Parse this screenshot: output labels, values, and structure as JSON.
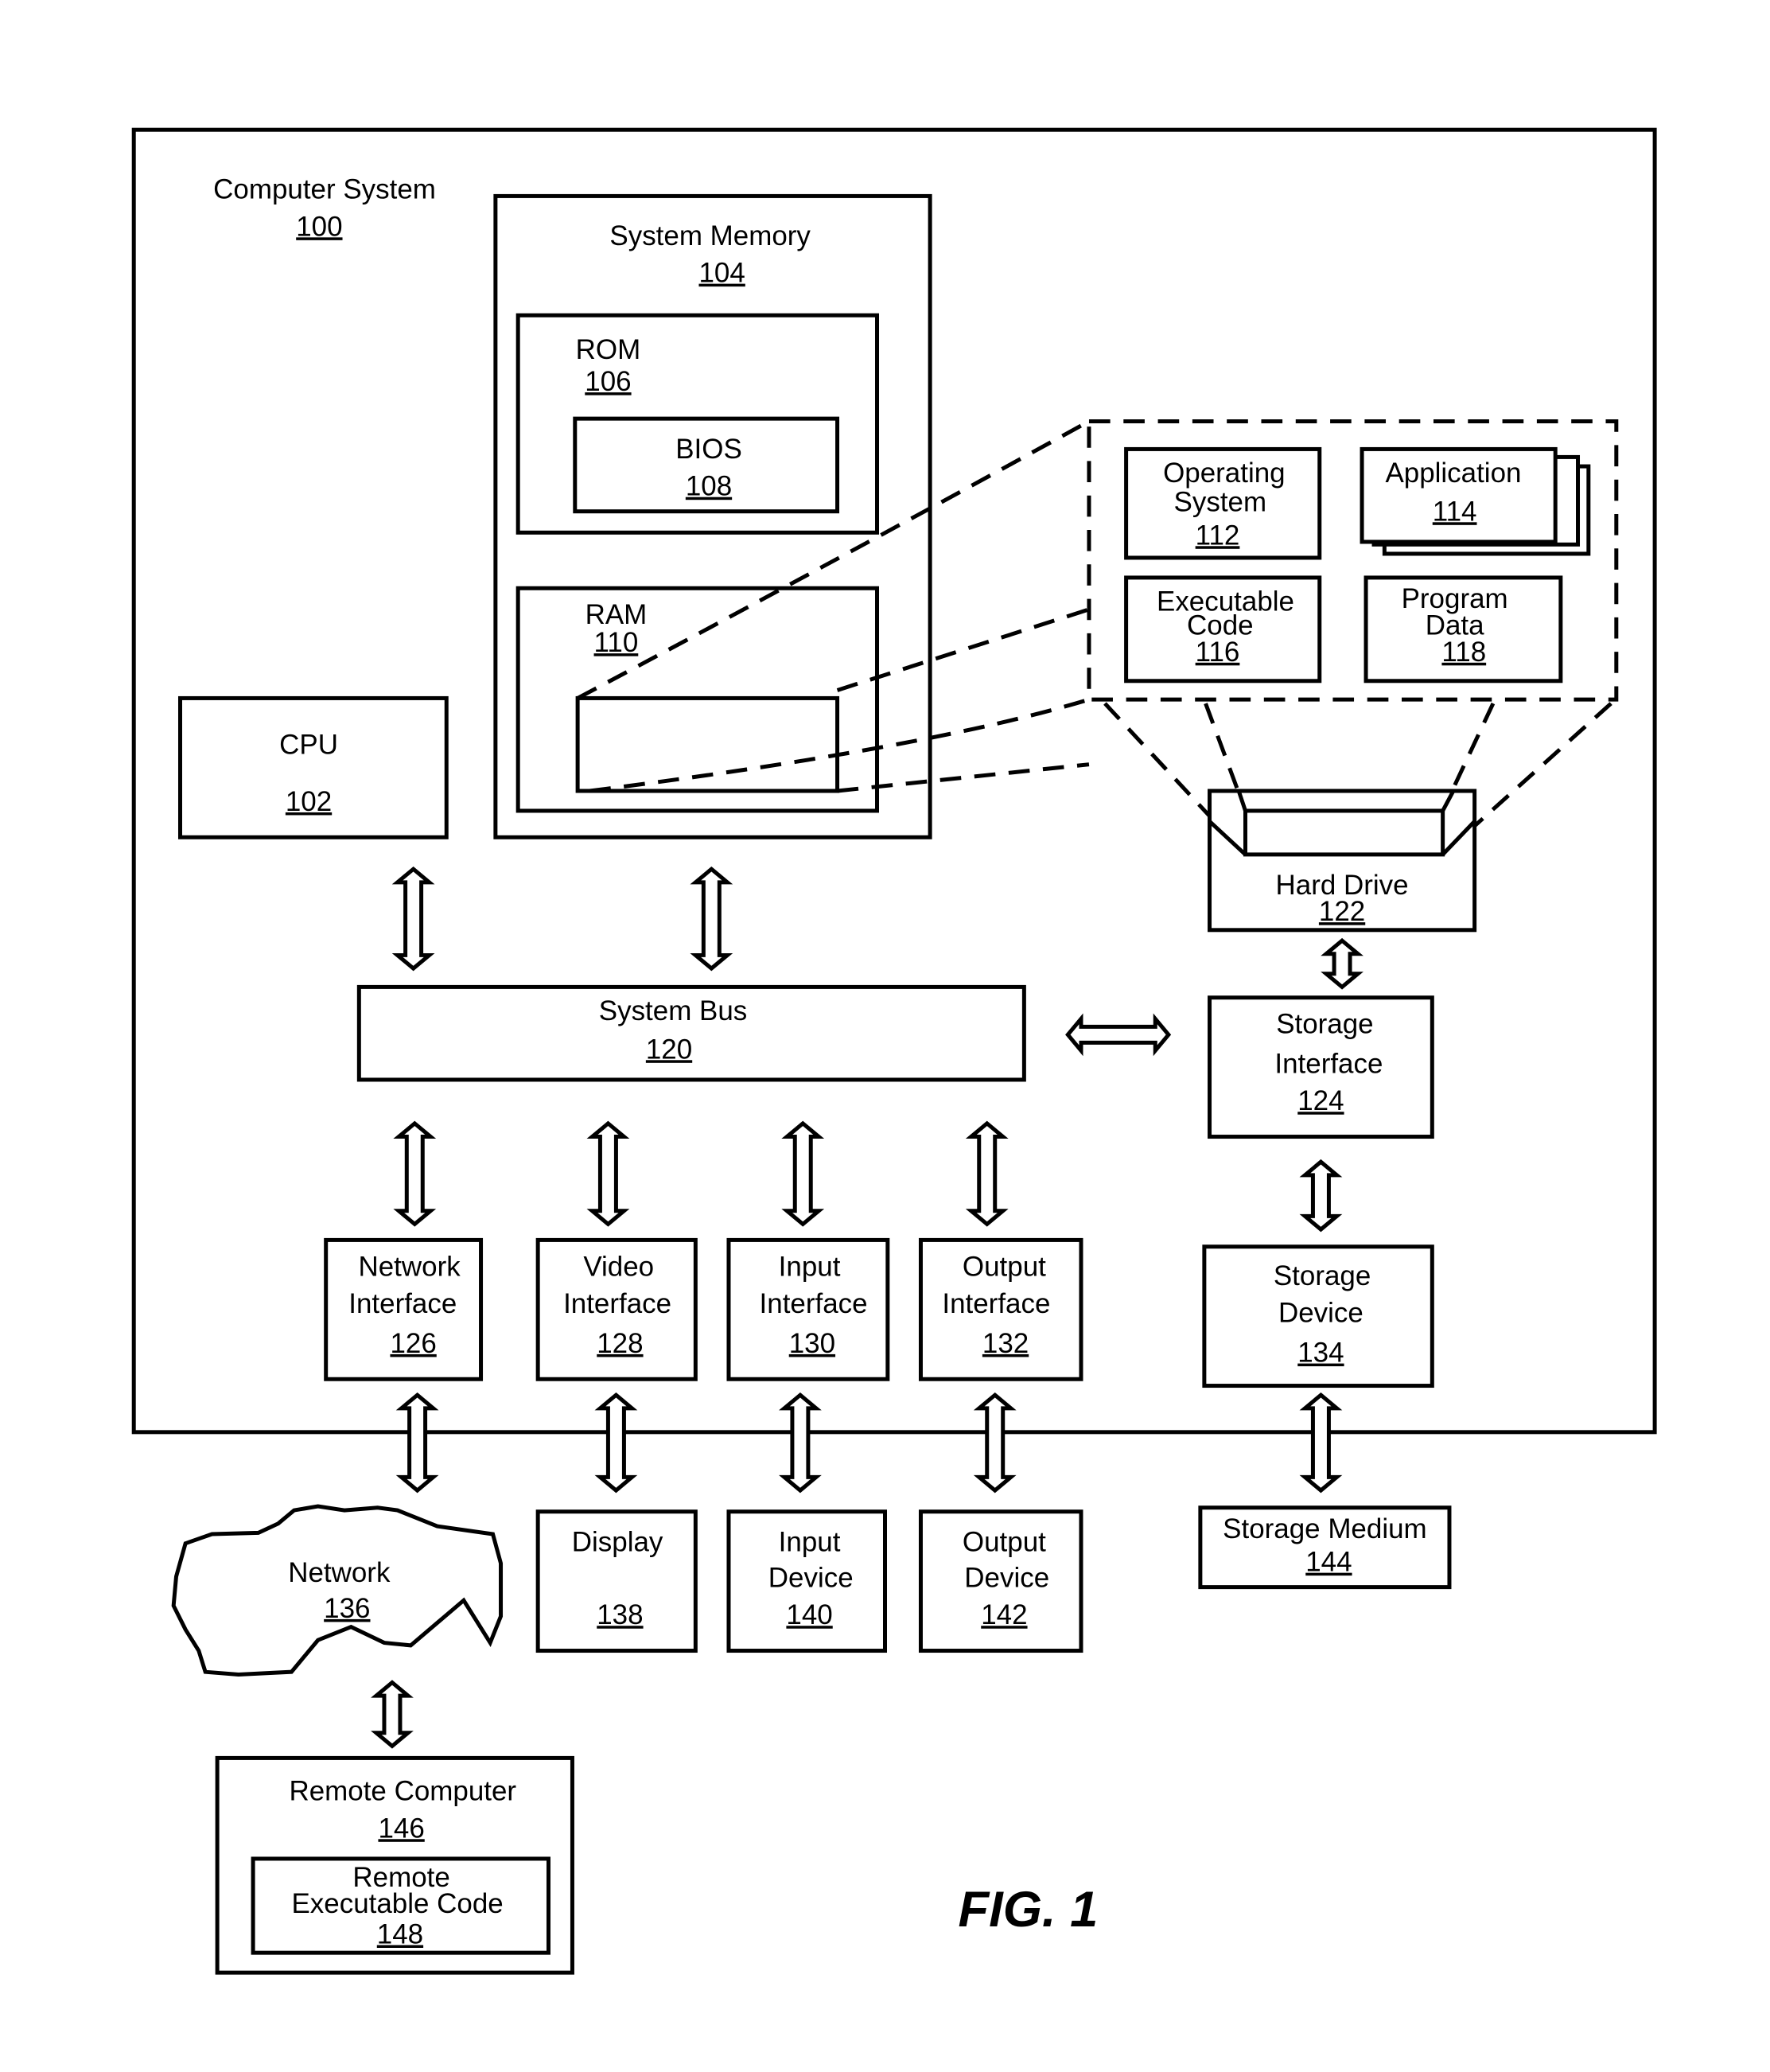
{
  "figure_label": "FIG. 1",
  "components": {
    "computer_system": {
      "label": "Computer System",
      "ref": "100"
    },
    "cpu": {
      "label": "CPU",
      "ref": "102"
    },
    "system_memory": {
      "label": "System Memory",
      "ref": "104"
    },
    "rom": {
      "label": "ROM",
      "ref": "106"
    },
    "bios": {
      "label": "BIOS",
      "ref": "108"
    },
    "ram": {
      "label": "RAM",
      "ref": "110"
    },
    "operating_system": {
      "label_lines": [
        "Operating",
        "System"
      ],
      "ref": "112"
    },
    "application": {
      "label": "Application",
      "ref": "114"
    },
    "executable_code": {
      "label_lines": [
        "Executable",
        "Code"
      ],
      "ref": "116"
    },
    "program_data": {
      "label_lines": [
        "Program",
        "Data"
      ],
      "ref": "118"
    },
    "system_bus": {
      "label": "System Bus",
      "ref": "120"
    },
    "hard_drive": {
      "label": "Hard Drive",
      "ref": "122"
    },
    "storage_interface": {
      "label_lines": [
        "Storage",
        "Interface"
      ],
      "ref": "124"
    },
    "network_interface": {
      "label_lines": [
        "Network",
        "Interface"
      ],
      "ref": "126"
    },
    "video_interface": {
      "label_lines": [
        "Video",
        "Interface"
      ],
      "ref": "128"
    },
    "input_interface": {
      "label_lines": [
        "Input",
        "Interface"
      ],
      "ref": "130"
    },
    "output_interface": {
      "label_lines": [
        "Output",
        "Interface"
      ],
      "ref": "132"
    },
    "storage_device": {
      "label_lines": [
        "Storage",
        "Device"
      ],
      "ref": "134"
    },
    "network": {
      "label": "Network",
      "ref": "136"
    },
    "display": {
      "label": "Display",
      "ref": "138"
    },
    "input_device": {
      "label_lines": [
        "Input",
        "Device"
      ],
      "ref": "140"
    },
    "output_device": {
      "label_lines": [
        "Output",
        "Device"
      ],
      "ref": "142"
    },
    "storage_medium": {
      "label": "Storage Medium",
      "ref": "144"
    },
    "remote_computer": {
      "label": "Remote Computer",
      "ref": "146"
    },
    "remote_executable_code": {
      "label_lines": [
        "Remote",
        "Executable Code"
      ],
      "ref": "148"
    }
  }
}
